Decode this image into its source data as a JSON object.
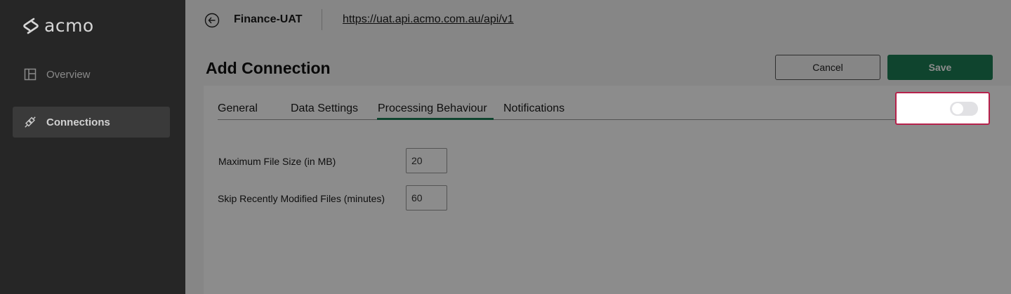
{
  "app": {
    "logo_text": "acmo"
  },
  "sidebar": {
    "items": [
      {
        "label": "Overview",
        "icon": "layout-icon",
        "active": false
      },
      {
        "label": "Connections",
        "icon": "plug-icon",
        "active": true
      }
    ]
  },
  "header": {
    "environment": "Finance-UAT",
    "url": "https://uat.api.acmo.com.au/api/v1"
  },
  "page": {
    "title": "Add Connection",
    "cancel_label": "Cancel",
    "save_label": "Save"
  },
  "tabs": [
    {
      "label": "General",
      "active": false
    },
    {
      "label": "Data Settings",
      "active": false
    },
    {
      "label": "Processing Behaviour",
      "active": true
    },
    {
      "label": "Notifications",
      "active": false
    }
  ],
  "form": {
    "max_file_size": {
      "label": "Maximum File Size (in MB)",
      "value": "20"
    },
    "skip_recent": {
      "label": "Skip Recently Modified Files (minutes)",
      "value": "60"
    }
  },
  "toggle": {
    "state": "off"
  },
  "colors": {
    "accent": "#1c7c54",
    "highlight": "#b5214b",
    "sidebar_bg": "#262626"
  }
}
